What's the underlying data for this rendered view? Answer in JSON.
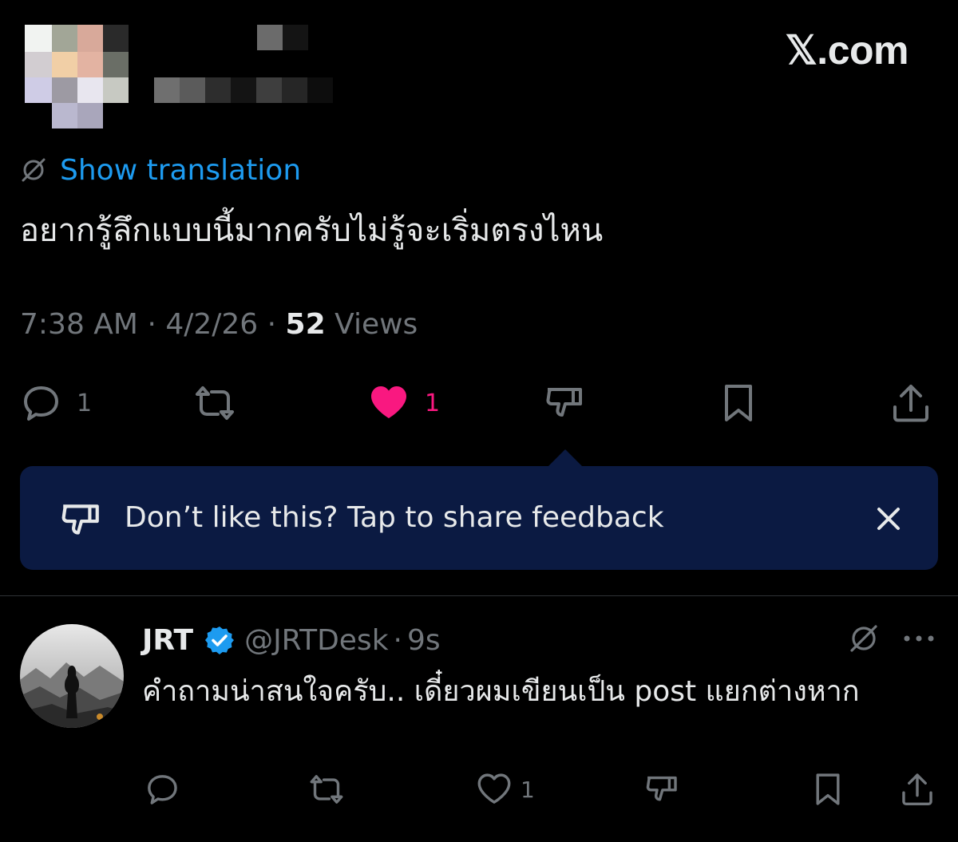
{
  "brand": {
    "label": "𝕏.com"
  },
  "header": {
    "avatar_note": "pixelated",
    "name_note": "pixelated"
  },
  "post": {
    "show_translation_label": "Show translation",
    "text": "อยากรู้ลึกแบบนี้มากครับไม่รู้จะเริ่มตรงไหน",
    "time": "7:38 AM",
    "date": "4/2/26",
    "views_count": "52",
    "views_label": "Views",
    "actions": {
      "reply_count": "1",
      "like_count": "1"
    }
  },
  "feedback_banner": {
    "text": "Don’t like this? Tap to share feedback"
  },
  "reply": {
    "name": "JRT",
    "handle": "@JRTDesk",
    "separator": "·",
    "time": "9s",
    "text": "คำถามน่าสนใจครับ.. เดี๋ยวผมเขียนเป็น post แยกต่างหาก",
    "actions": {
      "like_count": "1"
    }
  },
  "colors": {
    "background": "#000000",
    "link": "#1d9bf0",
    "like": "#f91880",
    "muted": "#71767b",
    "banner": "#0b1a42",
    "verified": "#1d9bf0"
  }
}
